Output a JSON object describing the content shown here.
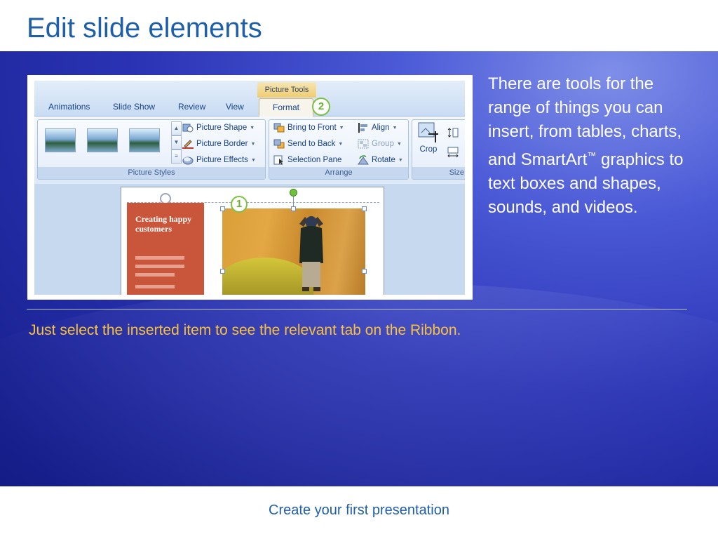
{
  "slide": {
    "title": "Edit slide elements",
    "body_text": [
      "There are tools for the range of things you can insert, from tables, charts, and SmartArt",
      "™",
      " graphics to text boxes and shapes, sounds, and videos."
    ],
    "tip_text": "Just select the inserted item to see the relevant tab on the Ribbon.",
    "footer": "Create your first presentation"
  },
  "screenshot": {
    "contextual_tab_label": "Picture Tools",
    "tabs": [
      "Animations",
      "Slide Show",
      "Review",
      "View",
      "Format"
    ],
    "callouts": [
      "2",
      "1"
    ],
    "groups": {
      "picture_styles": {
        "label": "Picture Styles",
        "commands": [
          "Picture Shape",
          "Picture Border",
          "Picture Effects"
        ]
      },
      "arrange": {
        "label": "Arrange",
        "commands": [
          "Bring to Front",
          "Send to Back",
          "Selection Pane",
          "Align",
          "Group",
          "Rotate"
        ]
      },
      "size": {
        "label": "Size",
        "commands": [
          "Crop"
        ]
      }
    },
    "slide_preview": {
      "heading": "Creating happy customers"
    }
  },
  "colors": {
    "title": "#1f5fa8",
    "background_blue": "#2a33b4",
    "tip_text": "#f9c23a",
    "callout_green": "#7bc142",
    "preview_red": "#c9553b"
  }
}
